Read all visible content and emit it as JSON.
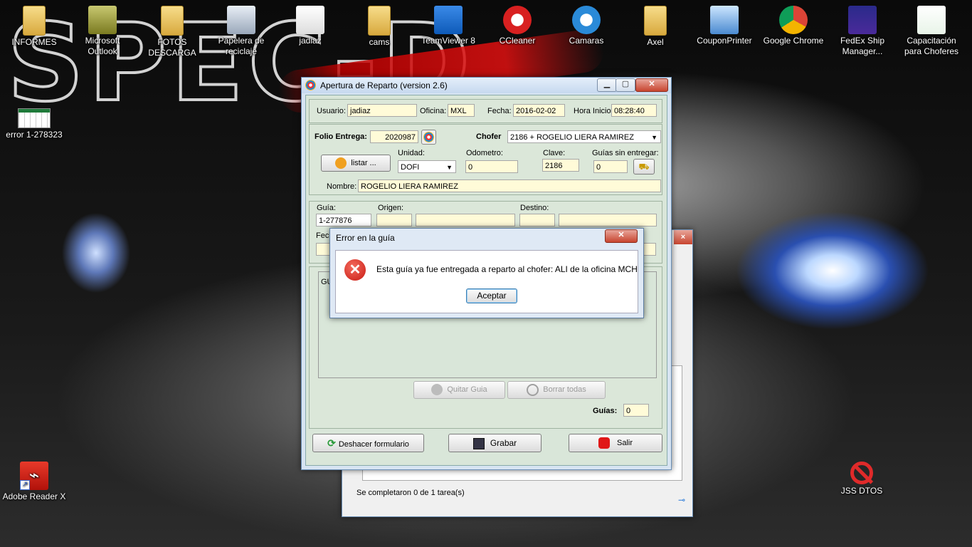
{
  "desktop": {
    "icons_top": [
      {
        "label": "INFORMES",
        "icon": "folder-icon"
      },
      {
        "label": "Microsoft Outlook",
        "icon": "outlook-icon"
      },
      {
        "label": "FOTOS DESCARGA",
        "icon": "folder-icon"
      },
      {
        "label": "Papelera de reciclaje",
        "icon": "recycle-bin-icon"
      },
      {
        "label": "jadiaz",
        "icon": "firefox-file-icon"
      },
      {
        "label": "cams",
        "icon": "folder-icon"
      },
      {
        "label": "TeamViewer 8",
        "icon": "teamviewer-icon"
      },
      {
        "label": "CCleaner",
        "icon": "ccleaner-icon"
      },
      {
        "label": "Camaras",
        "icon": "internet-explorer-icon"
      },
      {
        "label": "Axel",
        "icon": "folder-icon"
      },
      {
        "label": "CouponPrinter",
        "icon": "computer-icon"
      },
      {
        "label": "Google Chrome",
        "icon": "chrome-icon"
      },
      {
        "label": "FedEx Ship Manager...",
        "icon": "fedex-icon"
      },
      {
        "label": "Capacitación para Choferes",
        "icon": "spreadsheet-icon"
      }
    ],
    "icon_error": "error 1-278323",
    "icon_adobe": "Adobe Reader X",
    "icon_jss": "JSS DTOS"
  },
  "main_window": {
    "title": "Apertura  de Reparto (version 2.6)",
    "usuario_label": "Usuario:",
    "usuario": "jadiaz",
    "oficina_label": "Oficina:",
    "oficina": "MXL",
    "fecha_label": "Fecha:",
    "fecha": "2016-02-02",
    "hora_label": "Hora Inicio:",
    "hora": "08:28:40",
    "folio_label": "Folio Entrega:",
    "folio": "2020987",
    "chofer_label": "Chofer",
    "chofer": "2186 + ROGELIO LIERA RAMIREZ",
    "listar_label": "listar ...",
    "unidad_label": "Unidad:",
    "unidad": "DOFI",
    "odometro_label": "Odometro:",
    "odometro": "0",
    "clave_label": "Clave:",
    "clave": "2186",
    "guias_sin_label": "Guías sin entregar:",
    "guias_sin": "0",
    "nombre_label": "Nombre:",
    "nombre": "ROGELIO LIERA RAMIREZ",
    "guia_label": "Guía:",
    "guia": "1-277876",
    "origen_label": "Origen:",
    "destino_label": "Destino:",
    "fecha_short_label": "Fech",
    "grid_header": "GU",
    "quitar_label": "Quitar Guia",
    "borrar_label": "Borrar todas",
    "guias_label": "Guías:",
    "guias_count": "0",
    "deshacer_label": "Deshacer formulario",
    "grabar_label": "Grabar",
    "salir_label": "Salir"
  },
  "back_window": {
    "status": "Se completaron 0 de 1 tarea(s)"
  },
  "dialog": {
    "title": "Error en la guía",
    "message": "Esta guía ya fue entregada a reparto al chofer: ALI de la oficina MCH",
    "ok_label": "Aceptar"
  }
}
